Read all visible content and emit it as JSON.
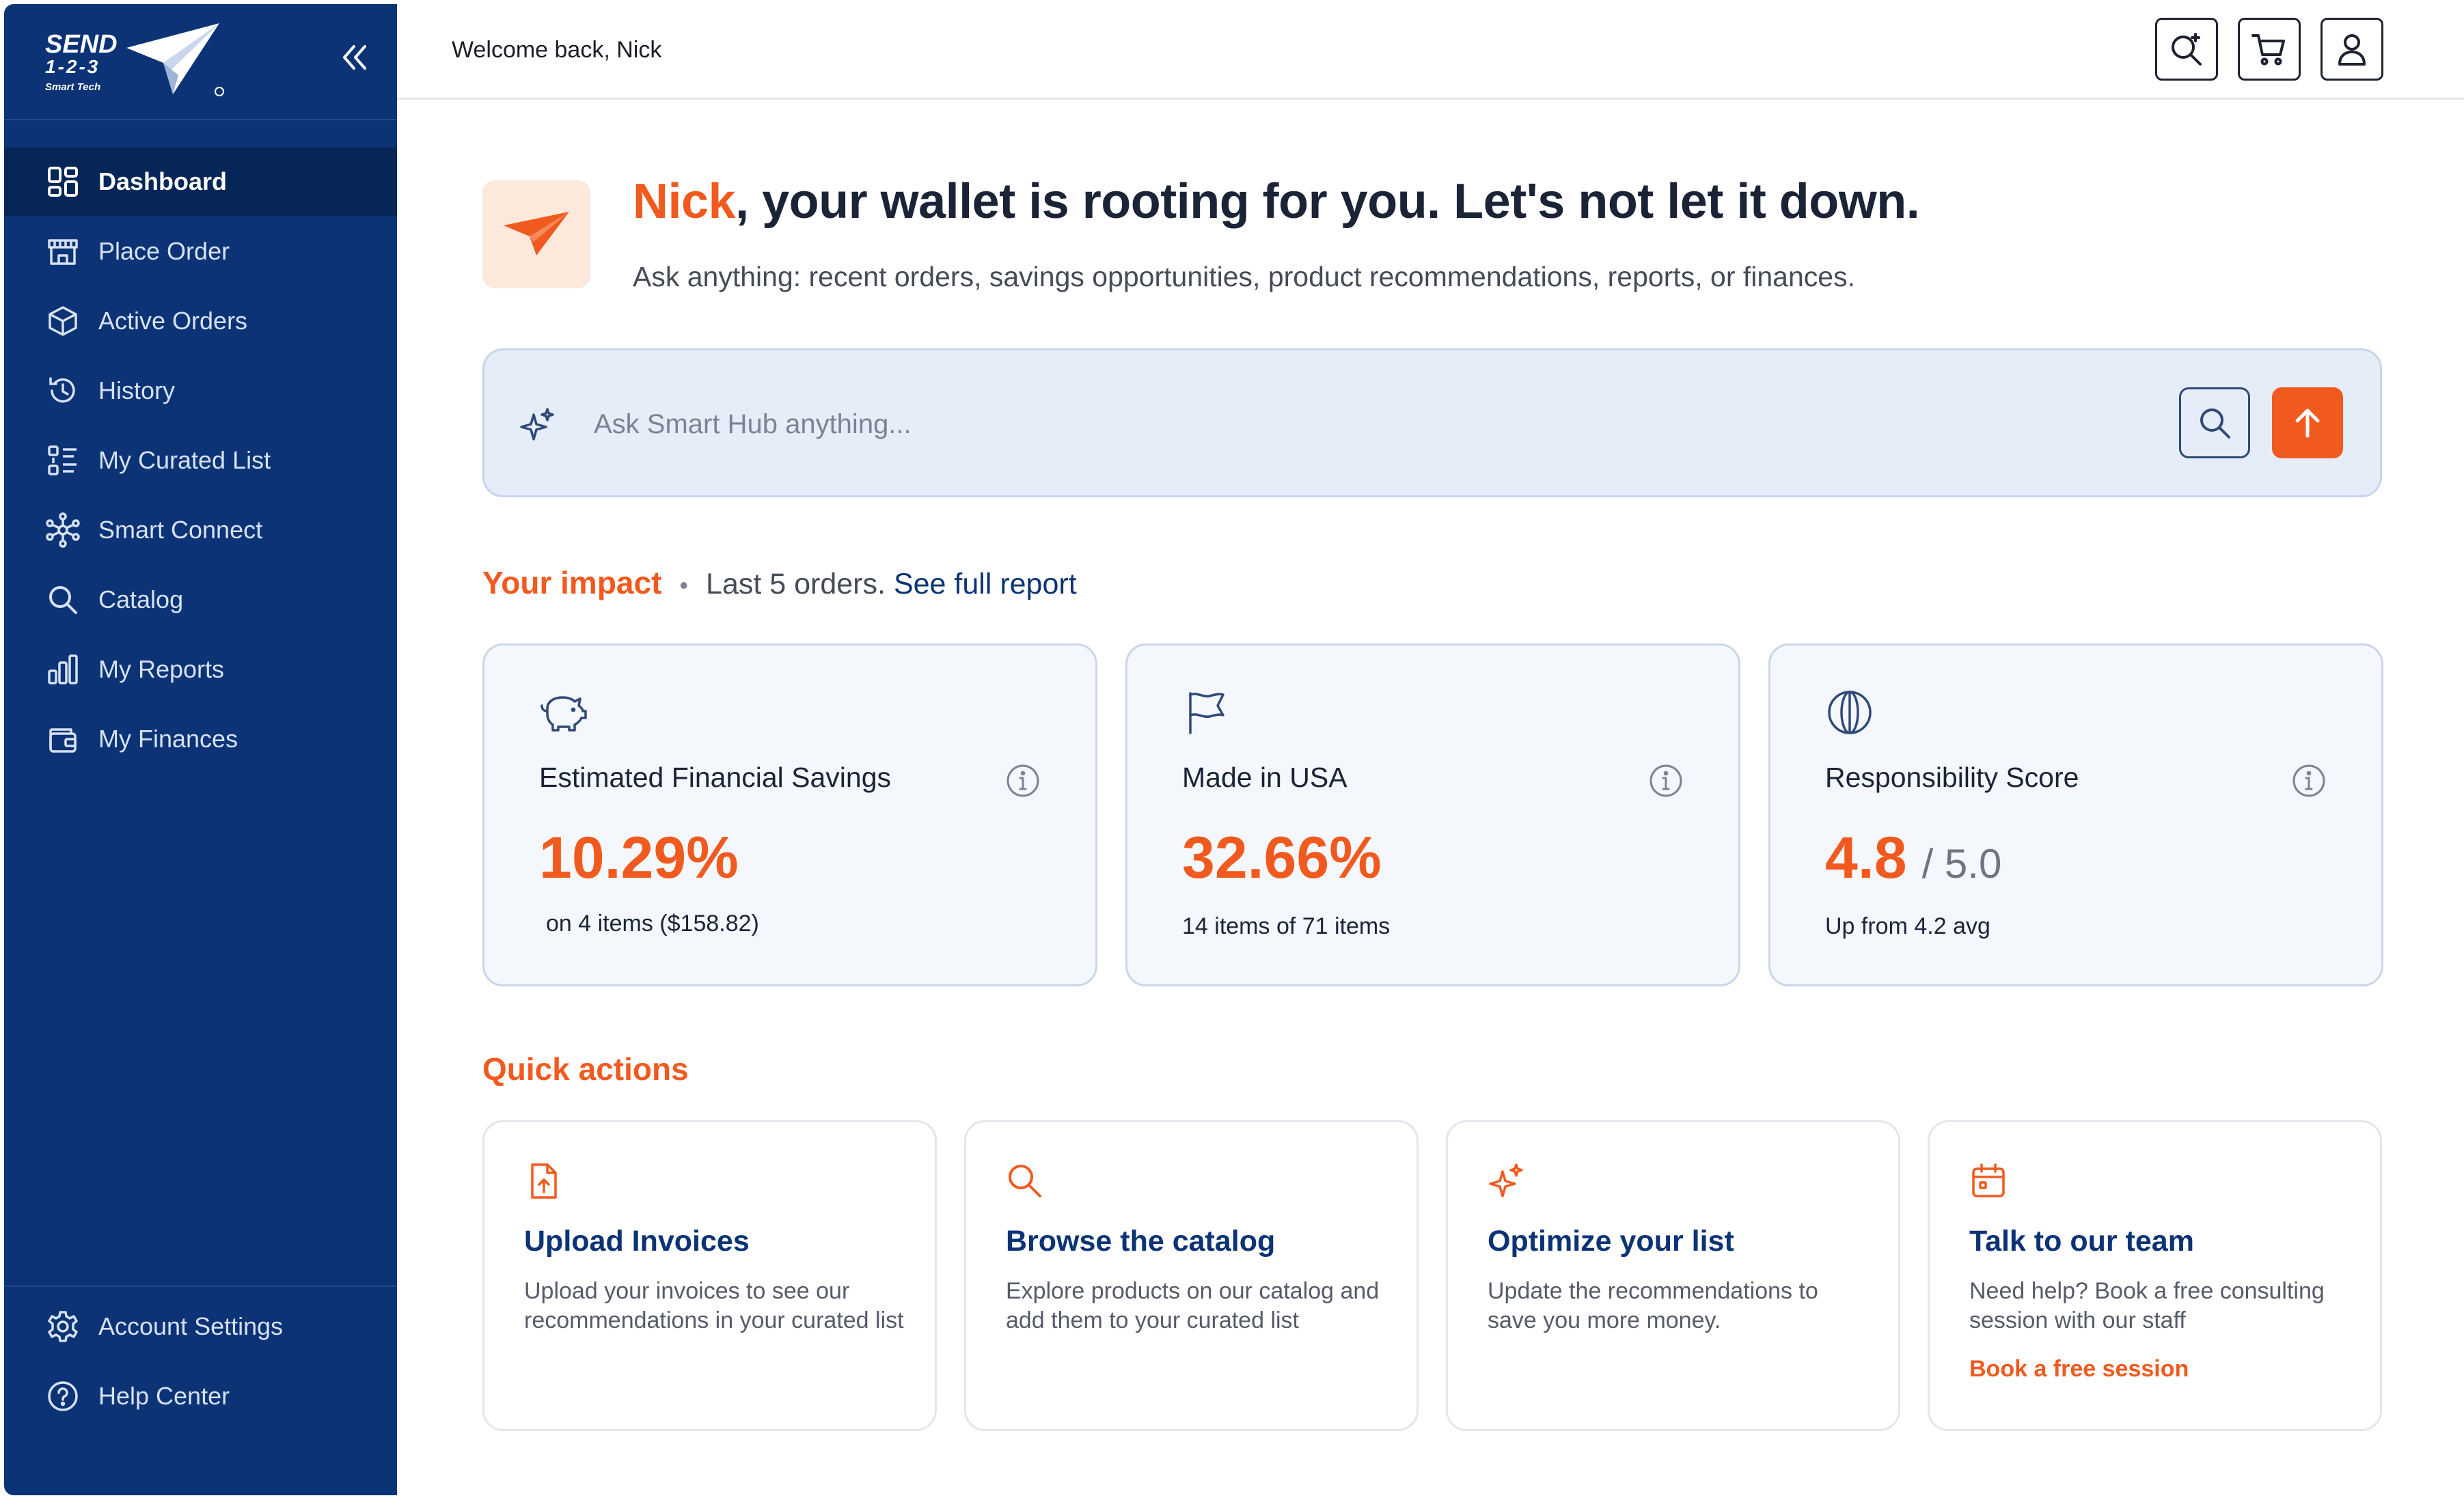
{
  "brand": {
    "line1": "SEND",
    "line2": "1-2-3",
    "line3": "Smart Tech",
    "accent_color": "#f15a1f",
    "sidebar_color": "#0b3376"
  },
  "sidebar": {
    "collapse_icon": "double-chevron-left-icon",
    "items": [
      {
        "label": "Dashboard",
        "icon": "dashboard-grid-icon",
        "active": true
      },
      {
        "label": "Place Order",
        "icon": "storefront-icon"
      },
      {
        "label": "Active Orders",
        "icon": "package-box-icon"
      },
      {
        "label": "History",
        "icon": "history-clock-icon"
      },
      {
        "label": "My Curated List",
        "icon": "list-icon"
      },
      {
        "label": "Smart Connect",
        "icon": "network-nodes-icon"
      },
      {
        "label": "Catalog",
        "icon": "search-icon"
      },
      {
        "label": "My Reports",
        "icon": "bar-chart-icon"
      },
      {
        "label": "My Finances",
        "icon": "wallet-icon"
      }
    ],
    "bottom_items": [
      {
        "label": "Account Settings",
        "icon": "gear-icon"
      },
      {
        "label": "Help Center",
        "icon": "help-circle-icon"
      }
    ]
  },
  "header": {
    "welcome": "Welcome back, Nick",
    "buttons": [
      "search-sparkle-icon",
      "cart-icon",
      "user-icon"
    ]
  },
  "hero": {
    "name": "Nick",
    "title_rest": ", your wallet is rooting for you. Let's not let it down.",
    "subtitle": "Ask anything: recent orders, savings opportunities, product recommendations, reports, or finances."
  },
  "search": {
    "placeholder": "Ask Smart Hub anything...",
    "value": ""
  },
  "impact": {
    "title": "Your impact",
    "meta": "Last 5 orders.",
    "link": "See full report",
    "cards": [
      {
        "icon": "piggy-bank-icon",
        "label": "Estimated Financial Savings",
        "value": "10.29%",
        "note": "on 4 items ($158.82)"
      },
      {
        "icon": "flag-icon",
        "label": "Made in USA",
        "value": "32.66%",
        "note": "14 items of 71 items"
      },
      {
        "icon": "globe-icon",
        "label": "Responsibility Score",
        "value": "4.8",
        "outof": "/ 5.0",
        "note": "Up from 4.2 avg"
      }
    ]
  },
  "quick_actions": {
    "title": "Quick actions",
    "cards": [
      {
        "icon": "upload-file-icon",
        "title": "Upload Invoices",
        "desc": "Upload your invoices to see our recommendations in your curated list"
      },
      {
        "icon": "search-icon",
        "title": "Browse the catalog",
        "desc": "Explore products on our catalog and add them to your curated list"
      },
      {
        "icon": "sparkle-icon",
        "title": "Optimize your list",
        "desc": "Update the recommendations to save you more money."
      },
      {
        "icon": "calendar-icon",
        "title": "Talk to our team",
        "desc": "Need help? Book a free consulting session with our staff",
        "link": "Book a free session"
      }
    ]
  }
}
